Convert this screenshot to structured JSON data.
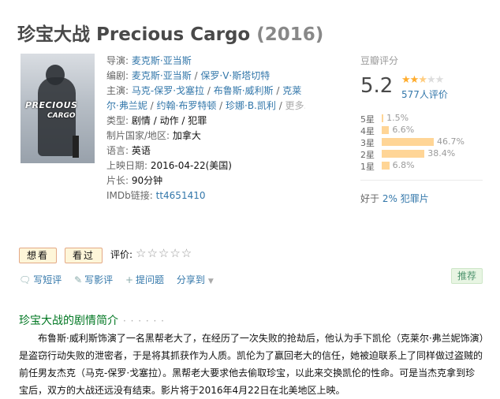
{
  "movie": {
    "title": "珍宝大战 Precious Cargo",
    "year": "(2016)"
  },
  "poster": {
    "title_line1": "PRECIOUS",
    "title_line2": "CARGO"
  },
  "info": {
    "director_label": "导演:",
    "director": "麦克斯·亚当斯",
    "writer_label": "编剧:",
    "writers": [
      "麦克斯·亚当斯",
      "保罗·V·斯塔切特"
    ],
    "cast_label": "主演:",
    "cast_line1": [
      "马克-保罗·戈塞拉",
      "布鲁斯·威利斯",
      "克莱"
    ],
    "cast_line2": [
      "尔·弗兰妮",
      "约翰·布罗特顿",
      "珍娜·B.凯利"
    ],
    "cast_more": "更多...",
    "genre_label": "类型:",
    "genres": [
      "剧情",
      "动作",
      "犯罪"
    ],
    "country_label": "制片国家/地区:",
    "country": "加拿大",
    "language_label": "语言:",
    "language": "英语",
    "release_label": "上映日期:",
    "release": "2016-04-22(美国)",
    "runtime_label": "片长:",
    "runtime": "90分钟",
    "imdb_label": "IMDb链接:",
    "imdb": "tt4651410",
    "sep": " / "
  },
  "rating": {
    "label": "豆瓣评分",
    "score": "5.2",
    "stars_value": 2.5,
    "stars_full": "★★",
    "stars_half": "★",
    "stars_empty": "★★",
    "votes": "577人评价",
    "distribution": [
      {
        "label": "5星",
        "pct": "1.5%",
        "value": 1.5
      },
      {
        "label": "4星",
        "pct": "6.6%",
        "value": 6.6
      },
      {
        "label": "3星",
        "pct": "46.7%",
        "value": 46.7
      },
      {
        "label": "2星",
        "pct": "38.4%",
        "value": 38.4
      },
      {
        "label": "1星",
        "pct": "6.8%",
        "value": 6.8
      }
    ],
    "better_prefix": "好于",
    "better_value": "2% 犯罪片"
  },
  "interest": {
    "want_label": "想看",
    "seen_label": "看过",
    "eval_label": "评价:",
    "eval_stars": "☆☆☆☆☆"
  },
  "actions": {
    "short_review": "写短评",
    "review": "写影评",
    "question": "提问题",
    "share": "分享到",
    "recommend": "推荐"
  },
  "synopsis": {
    "title": "珍宝大战的剧情简介",
    "dots": "· · · · · ·",
    "text": "布鲁斯·威利斯饰演了一名黑帮老大了，在经历了一次失败的抢劫后，他认为手下凯伦（克莱尔·弗兰妮饰演）是盗窃行动失败的泄密者，于是将其抓获作为人质。凯伦为了赢回老大的信任，她被迫联系上了同样做过盗贼的前任男友杰克（马克-保罗·戈塞拉）。黑帮老大要求他去偷取珍宝，以此来交换凯伦的性命。可是当杰克拿到珍宝后，双方的大战还远没有结束。影片将于2016年4月22日在北美地区上映。"
  }
}
